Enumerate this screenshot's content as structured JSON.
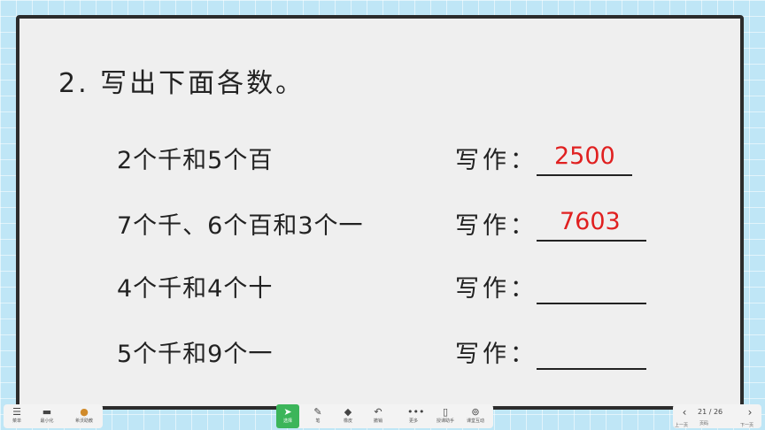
{
  "slide": {
    "title": "2. 写出下面各数。",
    "rows": [
      {
        "question": "2个千和5个百",
        "label": "写作：",
        "answer": "2500"
      },
      {
        "question": "7个千、6个百和3个一",
        "label": "写作：",
        "answer": "7603"
      },
      {
        "question": "4个千和4个十",
        "label": "写作：",
        "answer": ""
      },
      {
        "question": "5个千和9个一",
        "label": "写作：",
        "answer": ""
      }
    ]
  },
  "toolbar": {
    "left": [
      {
        "icon": "menu-icon",
        "label": "菜单"
      },
      {
        "icon": "minimize-icon",
        "label": "最小化"
      },
      {
        "icon": "avatar-icon",
        "label": "希沃助教"
      }
    ],
    "center": [
      {
        "icon": "pointer-icon",
        "label": "选择"
      },
      {
        "icon": "pen-icon",
        "label": "笔"
      },
      {
        "icon": "eraser-icon",
        "label": "橡皮"
      },
      {
        "icon": "undo-icon",
        "label": "撤销"
      },
      {
        "icon": "more-icon",
        "label": "更多"
      },
      {
        "icon": "phone-icon",
        "label": "授课助手"
      },
      {
        "icon": "location-icon",
        "label": "课堂互动"
      }
    ],
    "pager": {
      "current": "21",
      "total": "26",
      "text": "21 / 26",
      "sub": "页码",
      "prev_label": "上一页",
      "next_label": "下一页"
    }
  }
}
